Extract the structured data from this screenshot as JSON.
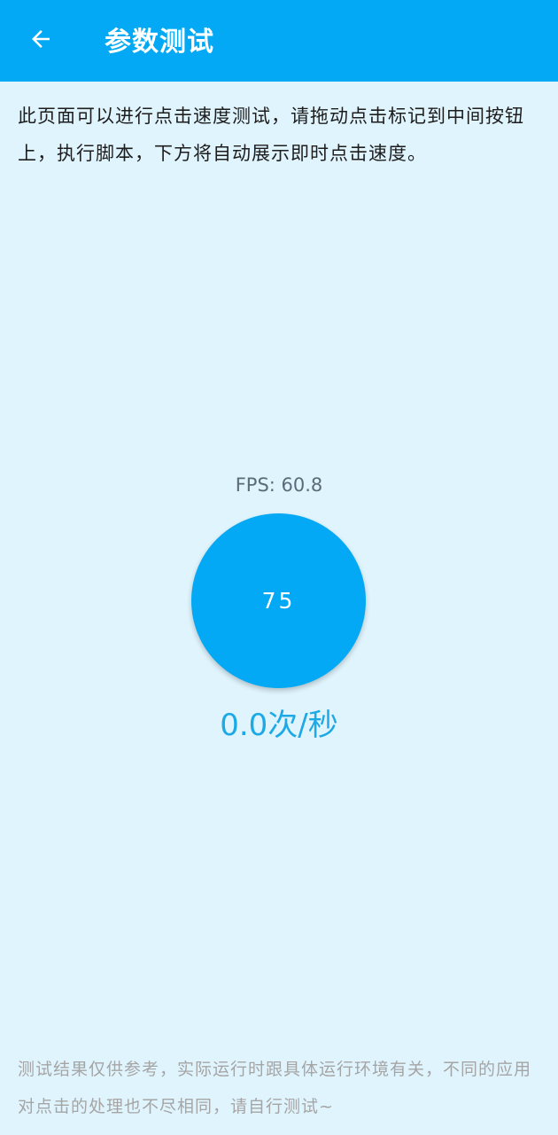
{
  "header": {
    "back_icon": "arrow-left-icon",
    "title": "参数测试"
  },
  "intro_text": "此页面可以进行点击速度测试，请拖动点击标记到中间按钮上，执行脚本，下方将自动展示即时点击速度。",
  "test_area": {
    "fps_text": "FPS: 60.8",
    "tap_count": "75",
    "speed_text": "0.0次/秒"
  },
  "footer_note": "测试结果仅供参考，实际运行时跟具体运行环境有关，不同的应用对点击的处理也不尽相同，请自行测试~",
  "colors": {
    "primary": "#03a9f4",
    "background": "#e0f4fd",
    "speed_text": "#1da9e6"
  }
}
